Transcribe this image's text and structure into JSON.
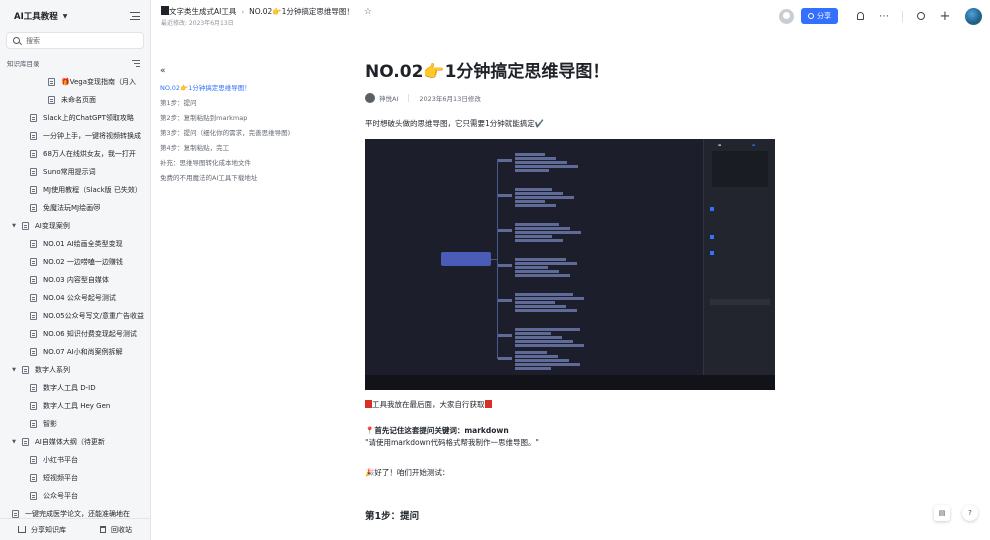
{
  "sidebar": {
    "title": "AI工具教程",
    "search_placeholder": "搜索",
    "section_label": "知识库目录",
    "items": [
      {
        "label": "🎁Vega变现指南（月入",
        "kind": "doc",
        "level": 2
      },
      {
        "label": "未命名页面",
        "kind": "doc",
        "level": 2
      },
      {
        "label": "Slack上的ChatGPT领取攻略",
        "kind": "doc",
        "level": 1
      },
      {
        "label": "一分钟上手，一键将视频转换成",
        "kind": "doc",
        "level": 1
      },
      {
        "label": "68万人在线烘女友，我一打开",
        "kind": "doc",
        "level": 1
      },
      {
        "label": "Suno常用提示词",
        "kind": "doc",
        "level": 1
      },
      {
        "label": "MJ使用教程（Slack版 已失效）",
        "kind": "doc",
        "level": 1
      },
      {
        "label": "免魔法玩MJ绘画😻",
        "kind": "doc",
        "level": 1
      },
      {
        "label": "AI变现案例",
        "kind": "folder",
        "level": 0
      },
      {
        "label": "NO.01 AI绘画全类型变现",
        "kind": "doc",
        "level": 1
      },
      {
        "label": "NO.02 一边唠嗑一边赚钱",
        "kind": "doc",
        "level": 1
      },
      {
        "label": "NO.03 内容型自媒体",
        "kind": "doc",
        "level": 1
      },
      {
        "label": "NO.04 公众号起号测试",
        "kind": "doc",
        "level": 1
      },
      {
        "label": "NO.05公众号写文/意重广告收益",
        "kind": "doc",
        "level": 1
      },
      {
        "label": "NO.06 知识付费变现起号测试",
        "kind": "doc",
        "level": 1
      },
      {
        "label": "NO.07 AI小和尚案例拆解",
        "kind": "doc",
        "level": 1
      },
      {
        "label": "数字人系列",
        "kind": "folder",
        "level": 0
      },
      {
        "label": "数字人工具 D-ID",
        "kind": "doc",
        "level": 1
      },
      {
        "label": "数字人工具 Hey Gen",
        "kind": "doc",
        "level": 1
      },
      {
        "label": "智影",
        "kind": "doc",
        "level": 1
      },
      {
        "label": "AI自媒体大纲（待更新",
        "kind": "folder",
        "level": 0
      },
      {
        "label": "小红书平台",
        "kind": "doc",
        "level": 1
      },
      {
        "label": "短视频平台",
        "kind": "doc",
        "level": 1
      },
      {
        "label": "公众号平台",
        "kind": "doc",
        "level": 1
      },
      {
        "label": "一键完成医学论文，还能准确地在",
        "kind": "doc",
        "level": 0
      }
    ],
    "footer": {
      "share": "分享知识库",
      "trash": "回收站"
    }
  },
  "header": {
    "crumb_root": "文字类生成式AI工具",
    "crumb_current": "NO.02👉1分钟搞定思维导图！",
    "modified": "最近修改: 2023年6月13日",
    "share_label": "分享"
  },
  "outline": {
    "items": [
      "NO.02👉1分钟搞定思维导图！",
      "第1步：提问",
      "第2步：复制粘贴到markmap",
      "第3步：提问（细化你的需求，完善思维导图)",
      "第4步：复制粘贴，完工",
      "补充：思维导图转化成本地文件",
      "免费的不用魔法的AI工具下载地址"
    ]
  },
  "doc": {
    "title": "NO.02👉1分钟搞定思维导图！",
    "author": "神悦AI",
    "date": "2023年6月13日修改",
    "intro": "平时想破头做的思维导图，它只需要1分钟就能搞定✔️",
    "tools_note": "工具我放在最后面，大家自行获取",
    "keyword_prefix": "首先记住这套提问关键词：",
    "keyword": "markdown",
    "quote": "\"请使用markdown代码格式帮我制作一思维导图。\"",
    "start": "好了！咱们开始测试：",
    "step1": "第1步：提问"
  },
  "colors": {
    "accent": "#3370ff",
    "sidebar_bg": "#f5f6f7",
    "mindmap_bg": "#1c1f2b"
  }
}
